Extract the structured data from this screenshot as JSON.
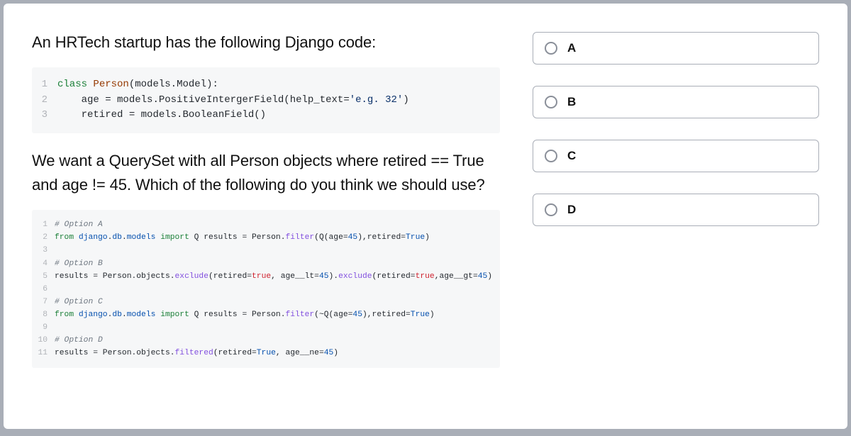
{
  "question": {
    "intro": "An HRTech startup has the following Django code:",
    "tail": "We want a QuerySet with all Person objects where retired == True and age != 45. Which of the following do you think we should use?"
  },
  "code_model": {
    "lines": [
      {
        "n": "1",
        "seg": [
          [
            "kw",
            "class"
          ],
          [
            "id",
            " "
          ],
          [
            "cls",
            "Person"
          ],
          [
            "op",
            "("
          ],
          [
            "id",
            "models"
          ],
          [
            "op",
            "."
          ],
          [
            "id",
            "Model"
          ],
          [
            "op",
            "):"
          ]
        ]
      },
      {
        "n": "2",
        "seg": [
          [
            "id",
            "    age "
          ],
          [
            "op",
            "="
          ],
          [
            "id",
            " models"
          ],
          [
            "op",
            "."
          ],
          [
            "id",
            "PositiveIntergerField"
          ],
          [
            "op",
            "("
          ],
          [
            "id",
            "help_text"
          ],
          [
            "op",
            "="
          ],
          [
            "str",
            "'e.g. 32'"
          ],
          [
            "op",
            ")"
          ]
        ]
      },
      {
        "n": "3",
        "seg": [
          [
            "id",
            "    retired "
          ],
          [
            "op",
            "="
          ],
          [
            "id",
            " models"
          ],
          [
            "op",
            "."
          ],
          [
            "id",
            "BooleanField"
          ],
          [
            "op",
            "()"
          ]
        ]
      }
    ]
  },
  "code_options": {
    "lines": [
      {
        "n": "1",
        "seg": [
          [
            "cm",
            "# Option A"
          ]
        ]
      },
      {
        "n": "2",
        "seg": [
          [
            "kw",
            "from"
          ],
          [
            "id",
            " "
          ],
          [
            "mod",
            "django"
          ],
          [
            "op",
            "."
          ],
          [
            "mod",
            "db"
          ],
          [
            "op",
            "."
          ],
          [
            "mod",
            "models"
          ],
          [
            "id",
            " "
          ],
          [
            "kw",
            "import"
          ],
          [
            "id",
            " Q results "
          ],
          [
            "op",
            "="
          ],
          [
            "id",
            " Person"
          ],
          [
            "op",
            "."
          ],
          [
            "fn",
            "filter"
          ],
          [
            "op",
            "("
          ],
          [
            "id",
            "Q"
          ],
          [
            "op",
            "("
          ],
          [
            "id",
            "age"
          ],
          [
            "op",
            "="
          ],
          [
            "num",
            "45"
          ],
          [
            "op",
            "),"
          ],
          [
            "id",
            "retired"
          ],
          [
            "op",
            "="
          ],
          [
            "bool",
            "True"
          ],
          [
            "op",
            ")"
          ]
        ]
      },
      {
        "n": "3",
        "seg": []
      },
      {
        "n": "4",
        "seg": [
          [
            "cm",
            "# Option B"
          ]
        ]
      },
      {
        "n": "5",
        "seg": [
          [
            "id",
            "results "
          ],
          [
            "op",
            "="
          ],
          [
            "id",
            " Person"
          ],
          [
            "op",
            "."
          ],
          [
            "id",
            "objects"
          ],
          [
            "op",
            "."
          ],
          [
            "fn",
            "exclude"
          ],
          [
            "op",
            "("
          ],
          [
            "id",
            "retired"
          ],
          [
            "op",
            "="
          ],
          [
            "nm",
            "true"
          ],
          [
            "op",
            ", "
          ],
          [
            "id",
            "age__lt"
          ],
          [
            "op",
            "="
          ],
          [
            "num",
            "45"
          ],
          [
            "op",
            ")."
          ],
          [
            "fn",
            "exclude"
          ],
          [
            "op",
            "("
          ],
          [
            "id",
            "retired"
          ],
          [
            "op",
            "="
          ],
          [
            "nm",
            "true"
          ],
          [
            "op",
            ","
          ],
          [
            "id",
            "age__gt"
          ],
          [
            "op",
            "="
          ],
          [
            "num",
            "45"
          ],
          [
            "op",
            ")"
          ]
        ]
      },
      {
        "n": "6",
        "seg": []
      },
      {
        "n": "7",
        "seg": [
          [
            "cm",
            "# Option C"
          ]
        ]
      },
      {
        "n": "8",
        "seg": [
          [
            "kw",
            "from"
          ],
          [
            "id",
            " "
          ],
          [
            "mod",
            "django"
          ],
          [
            "op",
            "."
          ],
          [
            "mod",
            "db"
          ],
          [
            "op",
            "."
          ],
          [
            "mod",
            "models"
          ],
          [
            "id",
            " "
          ],
          [
            "kw",
            "import"
          ],
          [
            "id",
            " Q results "
          ],
          [
            "op",
            "="
          ],
          [
            "id",
            " Person"
          ],
          [
            "op",
            "."
          ],
          [
            "fn",
            "filter"
          ],
          [
            "op",
            "(~"
          ],
          [
            "id",
            "Q"
          ],
          [
            "op",
            "("
          ],
          [
            "id",
            "age"
          ],
          [
            "op",
            "="
          ],
          [
            "num",
            "45"
          ],
          [
            "op",
            "),"
          ],
          [
            "id",
            "retired"
          ],
          [
            "op",
            "="
          ],
          [
            "bool",
            "True"
          ],
          [
            "op",
            ")"
          ]
        ]
      },
      {
        "n": "9",
        "seg": []
      },
      {
        "n": "10",
        "seg": [
          [
            "cm",
            "# Option D"
          ]
        ]
      },
      {
        "n": "11",
        "seg": [
          [
            "id",
            "results "
          ],
          [
            "op",
            "="
          ],
          [
            "id",
            " Person"
          ],
          [
            "op",
            "."
          ],
          [
            "id",
            "objects"
          ],
          [
            "op",
            "."
          ],
          [
            "fn",
            "filtered"
          ],
          [
            "op",
            "("
          ],
          [
            "id",
            "retired"
          ],
          [
            "op",
            "="
          ],
          [
            "bool",
            "True"
          ],
          [
            "op",
            ", "
          ],
          [
            "id",
            "age__ne"
          ],
          [
            "op",
            "="
          ],
          [
            "num",
            "45"
          ],
          [
            "op",
            ")"
          ]
        ]
      }
    ]
  },
  "answers": [
    {
      "label": "A"
    },
    {
      "label": "B"
    },
    {
      "label": "C"
    },
    {
      "label": "D"
    }
  ]
}
